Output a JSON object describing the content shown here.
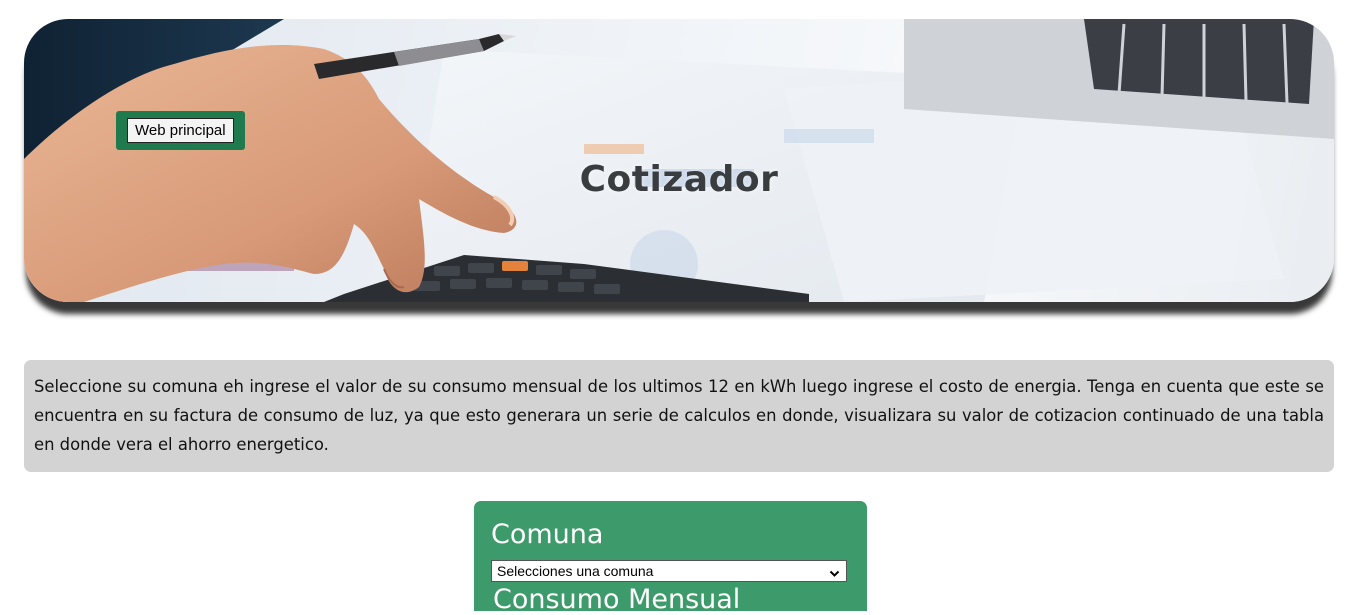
{
  "hero": {
    "title": "Cotizador",
    "nav_button_label": "Web principal"
  },
  "instructions": {
    "text": "Seleccione su comuna eh ingrese el valor de su consumo mensual de los ultimos 12 en kWh luego ingrese el costo de energia. Tenga en cuenta que este se encuentra en su factura de consumo de luz, ya que esto generara un serie de calculos en donde, visualizara su valor de cotizacion continuado de una tabla en donde vera el ahorro energetico."
  },
  "form": {
    "comuna_label": "Comuna",
    "comuna_select_value": "Selecciones una comuna",
    "next_label": "Consumo Mensual"
  },
  "colors": {
    "nav_bg": "#1f7a4d",
    "form_bg": "#3d9a6a",
    "instructions_bg": "#d4d3d4",
    "title_color": "#3a3d40"
  },
  "icons": {
    "select_arrow": "chevron-down-icon"
  }
}
